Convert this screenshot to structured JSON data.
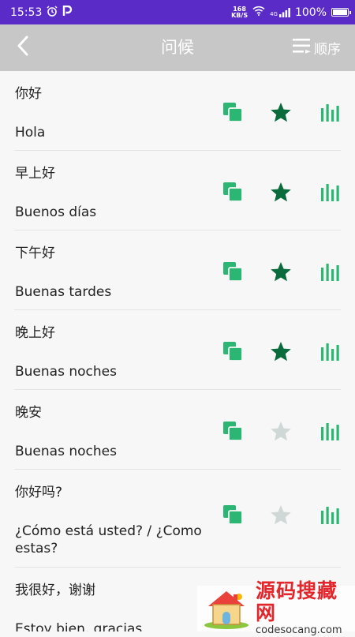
{
  "status_bar": {
    "time": "15:53",
    "speed_value": "168",
    "speed_unit": "KB/S",
    "network": "4G",
    "battery": "100%"
  },
  "header": {
    "title": "问候",
    "order_label": "顺序"
  },
  "colors": {
    "accent_green": "#2bb673",
    "star_dark": "#0a6b3c",
    "star_inactive": "#cfd8d6",
    "header_bg": "#c7c7c7",
    "status_bar_bg": "#5b2bc8"
  },
  "phrases": [
    {
      "chinese": "你好",
      "spanish": "Hola",
      "favorite": true
    },
    {
      "chinese": "早上好",
      "spanish": "Buenos días",
      "favorite": true
    },
    {
      "chinese": "下午好",
      "spanish": "Buenas tardes",
      "favorite": true
    },
    {
      "chinese": "晚上好",
      "spanish": "Buenas noches",
      "favorite": true
    },
    {
      "chinese": "晚安",
      "spanish": "Buenas noches",
      "favorite": false
    },
    {
      "chinese": "你好吗?",
      "spanish": "¿Cómo está usted? / ¿Como estas?",
      "favorite": false
    },
    {
      "chinese": "我很好，谢谢",
      "spanish": "Estoy bien, gracias",
      "favorite": false
    }
  ],
  "watermark": {
    "name": "源码搜藏网",
    "url": "codesocang.com"
  },
  "icons": {
    "back": "chevron-left-icon",
    "order": "sort-lines-icon",
    "copy": "copy-icon",
    "favorite": "star-icon",
    "play": "audio-bars-icon"
  }
}
